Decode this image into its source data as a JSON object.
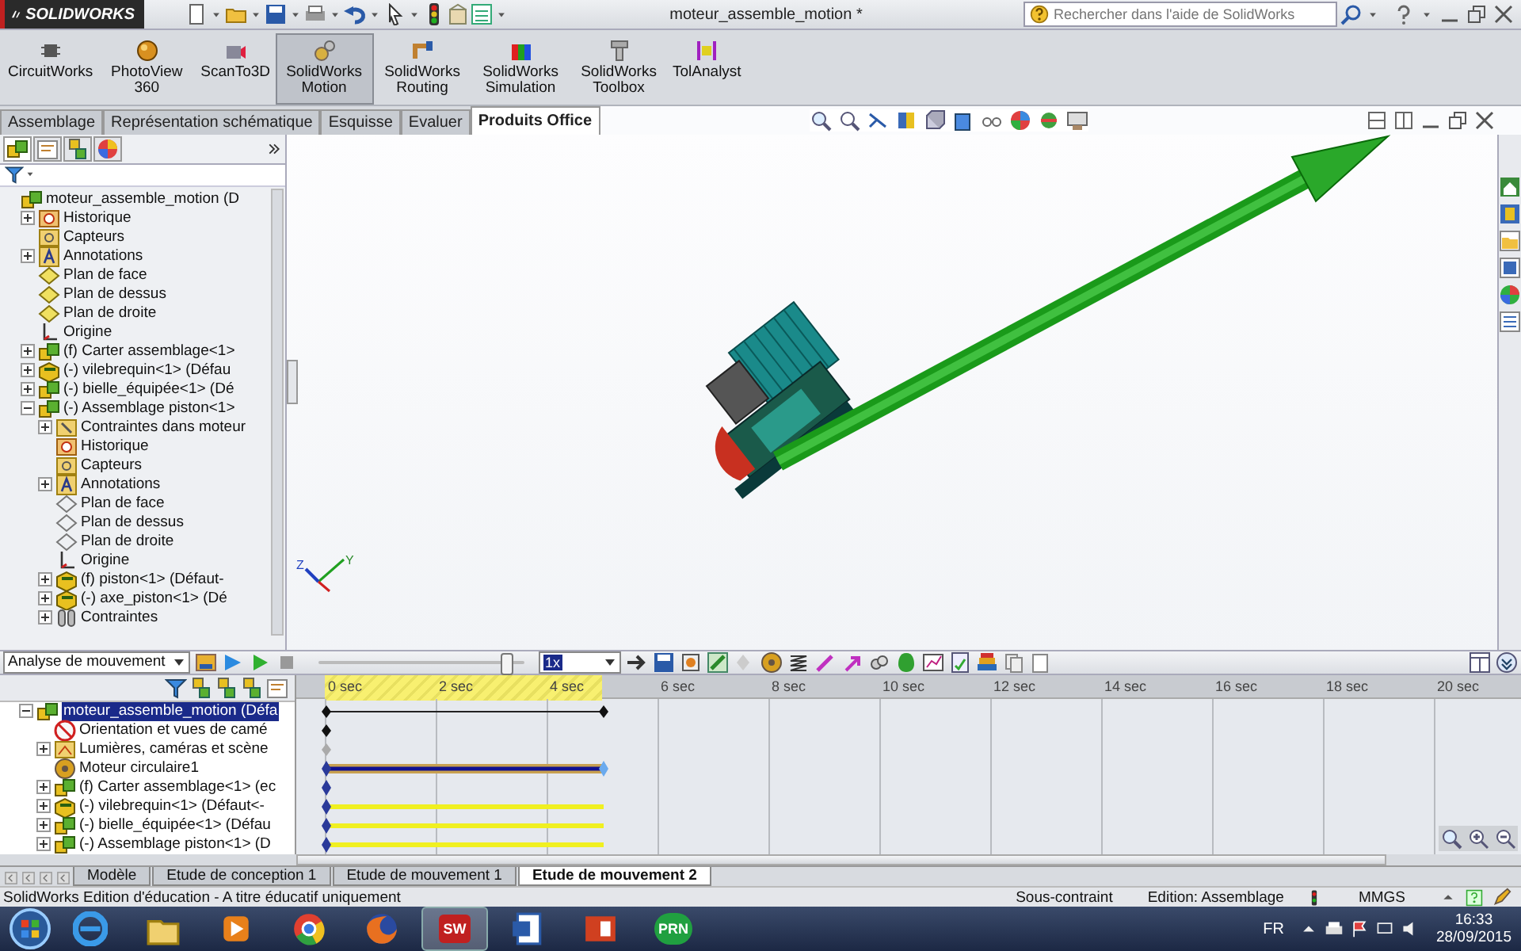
{
  "app": {
    "logo": "SOLIDWORKS",
    "title": "moteur_assemble_motion *",
    "help_search": {
      "placeholder": "Rechercher dans l'aide de SolidWorks"
    }
  },
  "addins": [
    {
      "label": "CircuitWorks",
      "selected": false
    },
    {
      "label": "PhotoView 360",
      "selected": false
    },
    {
      "label": "ScanTo3D",
      "selected": false
    },
    {
      "label": "SolidWorks Motion",
      "selected": true
    },
    {
      "label": "SolidWorks Routing",
      "selected": false
    },
    {
      "label": "SolidWorks Simulation",
      "selected": false
    },
    {
      "label": "SolidWorks Toolbox",
      "selected": false
    },
    {
      "label": "TolAnalyst",
      "selected": false
    }
  ],
  "tabs": [
    {
      "label": "Assemblage",
      "selected": false
    },
    {
      "label": "Représentation schématique",
      "selected": false
    },
    {
      "label": "Esquisse",
      "selected": false
    },
    {
      "label": "Evaluer",
      "selected": false
    },
    {
      "label": "Produits Office",
      "selected": true
    }
  ],
  "feature_tree": {
    "items": [
      {
        "label": "moteur_assemble_motion (D",
        "kind": "assembly",
        "children": [
          {
            "label": "Historique",
            "kind": "history",
            "expanded": false
          },
          {
            "label": "Capteurs",
            "kind": "sensor"
          },
          {
            "label": "Annotations",
            "kind": "annotation",
            "expanded": false
          },
          {
            "label": "Plan de face",
            "kind": "plane"
          },
          {
            "label": "Plan de dessus",
            "kind": "plane"
          },
          {
            "label": "Plan de droite",
            "kind": "plane"
          },
          {
            "label": "Origine",
            "kind": "origin"
          },
          {
            "label": "(f) Carter assemblage<1>",
            "kind": "assembly",
            "expanded": false
          },
          {
            "label": "(-) vilebrequin<1> (Défau",
            "kind": "part",
            "expanded": false
          },
          {
            "label": "(-) bielle_équipée<1> (Dé",
            "kind": "assembly",
            "expanded": false
          },
          {
            "label": "(-) Assemblage piston<1>",
            "kind": "assembly",
            "expanded": true,
            "children": [
              {
                "label": "Contraintes dans moteur",
                "kind": "mates-folder",
                "expanded": false
              },
              {
                "label": "Historique",
                "kind": "history"
              },
              {
                "label": "Capteurs",
                "kind": "sensor"
              },
              {
                "label": "Annotations",
                "kind": "annotation",
                "expanded": false
              },
              {
                "label": "Plan de face",
                "kind": "plane-hidden"
              },
              {
                "label": "Plan de dessus",
                "kind": "plane-hidden"
              },
              {
                "label": "Plan de droite",
                "kind": "plane-hidden"
              },
              {
                "label": "Origine",
                "kind": "origin"
              },
              {
                "label": "(f) piston<1> (Défaut-",
                "kind": "part",
                "expanded": false
              },
              {
                "label": "(-) axe_piston<1> (Dé",
                "kind": "part",
                "expanded": false
              },
              {
                "label": "Contraintes",
                "kind": "mates",
                "expanded": false
              }
            ]
          }
        ]
      }
    ]
  },
  "triad": {
    "labels": [
      "Z",
      "Y"
    ]
  },
  "motion_toolbar": {
    "study_type": "Analyse de mouvement",
    "slider": {
      "level": 0.96
    },
    "speed": "1x"
  },
  "timeline": {
    "ticks": [
      "0 sec",
      "2 sec",
      "4 sec",
      "6 sec",
      "8 sec",
      "10 sec",
      "12 sec",
      "14 sec",
      "16 sec",
      "18 sec",
      "20 sec"
    ]
  },
  "motion_tree": [
    {
      "label": "moteur_assemble_motion (Défa",
      "kind": "assembly",
      "expanded": true,
      "selected": true,
      "track": {
        "kind": "span"
      }
    },
    {
      "label": "Orientation et vues de camé",
      "kind": "camera",
      "selected": false,
      "track": {
        "kind": "key"
      }
    },
    {
      "label": "Lumières, caméras et scène",
      "kind": "lights",
      "expanded": false,
      "selected": false,
      "track": {
        "kind": "key-grey"
      }
    },
    {
      "label": "Moteur circulaire1",
      "kind": "motor",
      "selected": false,
      "track": {
        "kind": "motor"
      }
    },
    {
      "label": "(f) Carter assemblage<1> (ec",
      "kind": "assembly",
      "expanded": false,
      "selected": false,
      "track": {
        "kind": "key-blue"
      }
    },
    {
      "label": "(-) vilebrequin<1> (Défaut<-",
      "kind": "part",
      "expanded": false,
      "selected": false,
      "track": {
        "kind": "bar"
      }
    },
    {
      "label": "(-) bielle_équipée<1> (Défau",
      "kind": "assembly",
      "expanded": false,
      "selected": false,
      "track": {
        "kind": "bar"
      }
    },
    {
      "label": "(-) Assemblage piston<1> (D",
      "kind": "assembly",
      "expanded": false,
      "selected": false,
      "track": {
        "kind": "bar"
      }
    }
  ],
  "study_tabs": [
    {
      "label": "Modèle",
      "selected": false
    },
    {
      "label": "Etude de conception 1",
      "selected": false
    },
    {
      "label": "Etude de mouvement 1",
      "selected": false
    },
    {
      "label": "Etude de mouvement 2",
      "selected": true
    }
  ],
  "status_bar": {
    "edition": "SolidWorks Edition d'éducation - A titre éducatif uniquement",
    "state": "Sous-contraint",
    "mode": "Edition: Assemblage",
    "units": "MMGS"
  },
  "taskbar": {
    "apps": [
      {
        "kind": "ie",
        "active": false
      },
      {
        "kind": "explorer",
        "active": false
      },
      {
        "kind": "media",
        "active": false
      },
      {
        "kind": "chrome",
        "active": false
      },
      {
        "kind": "firefox",
        "active": false
      },
      {
        "kind": "solidworks",
        "active": true,
        "label": "SW"
      },
      {
        "kind": "word",
        "active": false
      },
      {
        "kind": "slides",
        "active": false
      },
      {
        "kind": "prn",
        "active": false,
        "label": "PRN"
      }
    ],
    "language": "FR",
    "time": "16:33",
    "date": "28/09/2015"
  }
}
